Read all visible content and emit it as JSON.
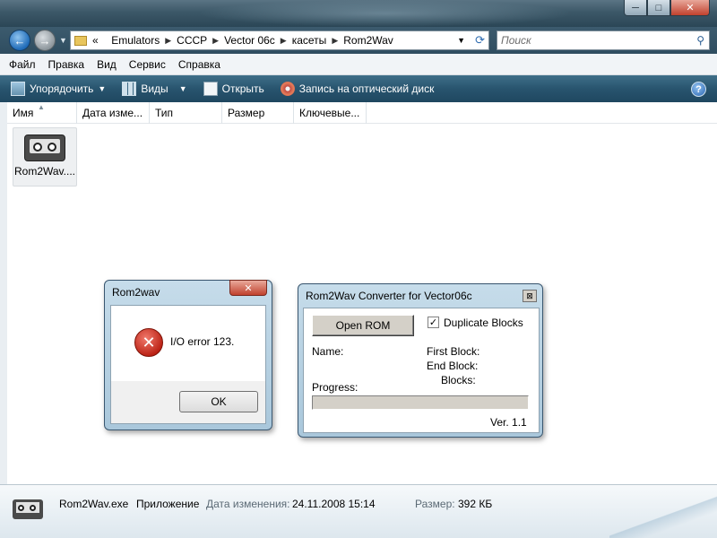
{
  "window": {
    "min_glyph": "─",
    "max_glyph": "□",
    "close_glyph": "✕"
  },
  "address": {
    "prefix": "«",
    "crumbs": [
      "Emulators",
      "СССР",
      "Vector 06c",
      "касеты",
      "Rom2Wav"
    ],
    "search_placeholder": "Поиск"
  },
  "menu": {
    "items": [
      "Файл",
      "Правка",
      "Вид",
      "Сервис",
      "Справка"
    ]
  },
  "toolbar": {
    "organize": "Упорядочить",
    "views": "Виды",
    "open": "Открыть",
    "burn": "Запись на оптический диск"
  },
  "columns": [
    "Имя",
    "Дата изме...",
    "Тип",
    "Размер",
    "Ключевые..."
  ],
  "files": [
    {
      "name": "Rom2Wav...."
    }
  ],
  "details": {
    "filename": "Rom2Wav.exe",
    "type": "Приложение",
    "modified_label": "Дата изменения:",
    "modified_value": "24.11.2008 15:14",
    "size_label": "Размер:",
    "size_value": "392 КБ"
  },
  "error_dialog": {
    "title": "Rom2wav",
    "message": "I/O error 123.",
    "ok": "OK"
  },
  "converter": {
    "title": "Rom2Wav Converter for Vector06c",
    "open_rom": "Open ROM",
    "duplicate_blocks": "Duplicate Blocks",
    "duplicate_checked": true,
    "name_label": "Name:",
    "first_block_label": "First Block:",
    "end_block_label": "End Block:",
    "blocks_label": "Blocks:",
    "progress_label": "Progress:",
    "progress_value": 0,
    "version": "Ver. 1.1"
  }
}
